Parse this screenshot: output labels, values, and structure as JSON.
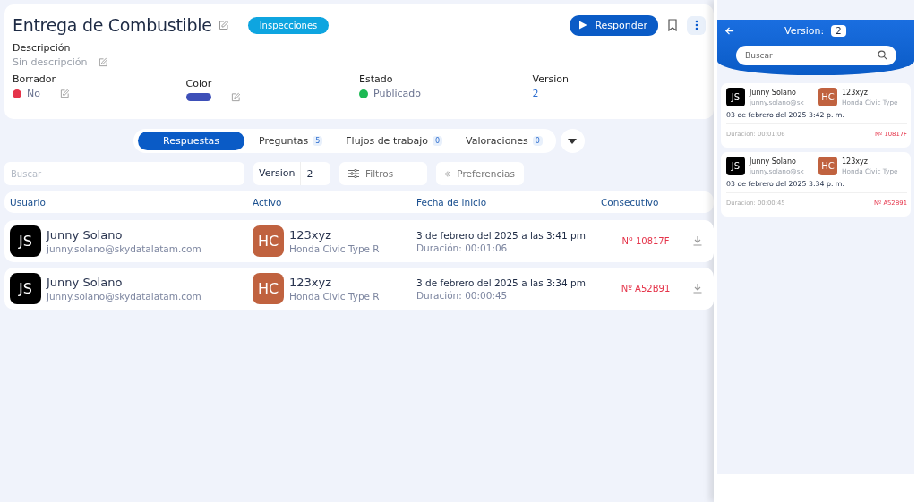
{
  "header": {
    "title": "Entrega de Combustible",
    "category": "Inspecciones",
    "respond_button": "Responder",
    "description_label": "Descripción",
    "description_value": "Sin descripción",
    "fields": [
      {
        "kind": "dot",
        "label": "Borrador",
        "value": "No",
        "color": "#e5344a"
      },
      {
        "kind": "swatch",
        "label": "Color",
        "color": "#3d4fb8"
      },
      {
        "kind": "dot",
        "label": "Estado",
        "value": "Publicado",
        "color": "#1db954"
      },
      {
        "kind": "link",
        "label": "Version",
        "value": "2"
      }
    ]
  },
  "tabs": [
    {
      "label": "Respuestas",
      "selected": true
    },
    {
      "label": "Preguntas",
      "count": "5",
      "selected": false
    },
    {
      "label": "Flujos de trabajo",
      "count": "0",
      "selected": false
    },
    {
      "label": "Valoraciones",
      "count": "0",
      "selected": false
    }
  ],
  "toolbar": {
    "search_placeholder": "Buscar",
    "version_label": "Version",
    "version_value": "2",
    "filters": "Filtros",
    "preferences": "Preferencias"
  },
  "table": {
    "columns": [
      "Usuario",
      "Activo",
      "Fecha de inicio",
      "Consecutivo"
    ],
    "rows": [
      {
        "initials": "JS",
        "name": "Junny Solano",
        "email": "junny.solano@skydatalatam.com",
        "asset_initials": "HC",
        "asset": "123xyz",
        "asset_model": "Honda Civic Type R",
        "date": "3 de febrero del 2025 a las 3:41 pm",
        "duration": "Duración: 00:01:06",
        "consecutive": "Nº 10817F"
      },
      {
        "initials": "JS",
        "name": "Junny Solano",
        "email": "junny.solano@skydatalatam.com",
        "asset_initials": "HC",
        "asset": "123xyz",
        "asset_model": "Honda Civic Type R",
        "date": "3 de febrero del 2025 a las 3:34 pm",
        "duration": "Duración: 00:00:45",
        "consecutive": "Nº A52B91"
      }
    ]
  },
  "side_panel": {
    "version_label": "Version:",
    "version_value": "2",
    "search_placeholder": "Buscar",
    "cards": [
      {
        "initials": "JS",
        "name": "Junny Solano",
        "email": "junny.solano@sk",
        "asset_initials": "HC",
        "asset": "123xyz",
        "asset_model": "Honda Civic Type",
        "date": "03 de febrero del 2025 3:42 p. m.",
        "duration": "Duracion: 00:01:06",
        "consecutive": "Nº 10817F"
      },
      {
        "initials": "JS",
        "name": "Junny Solano",
        "email": "junny.solano@sk",
        "asset_initials": "HC",
        "asset": "123xyz",
        "asset_model": "Honda Civic Type",
        "date": "03 de febrero del 2025 3:34 p. m.",
        "duration": "Duracion: 00:00:45",
        "consecutive": "Nº A52B91"
      }
    ]
  }
}
